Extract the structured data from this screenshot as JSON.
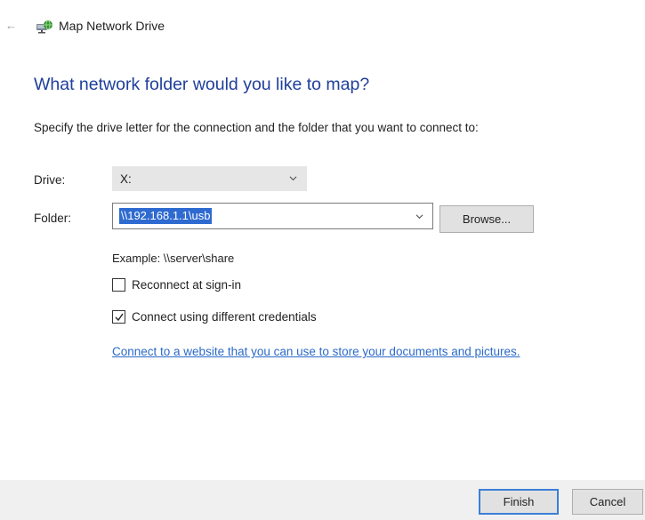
{
  "window": {
    "title": "Map Network Drive",
    "back_icon": "back-arrow-icon",
    "app_icon": "network-drive-icon"
  },
  "main": {
    "heading": "What network folder would you like to map?",
    "instruction": "Specify the drive letter for the connection and the folder that you want to connect to:"
  },
  "drive": {
    "label": "Drive:",
    "value": "X:"
  },
  "folder": {
    "label": "Folder:",
    "value": "\\\\192.168.1.1\\usb",
    "browse_label": "Browse..."
  },
  "example_text": "Example: \\\\server\\share",
  "options": {
    "reconnect": {
      "label": "Reconnect at sign-in",
      "checked": false
    },
    "credentials": {
      "label": "Connect using different credentials",
      "checked": true
    }
  },
  "link_text": "Connect to a website that you can use to store your documents and pictures.",
  "footer": {
    "finish_label": "Finish",
    "cancel_label": "Cancel"
  },
  "colors": {
    "heading": "#1f3f9c",
    "link": "#2b6ac9",
    "selection": "#2e6ad0",
    "default_button_border": "#3c7fd8"
  }
}
